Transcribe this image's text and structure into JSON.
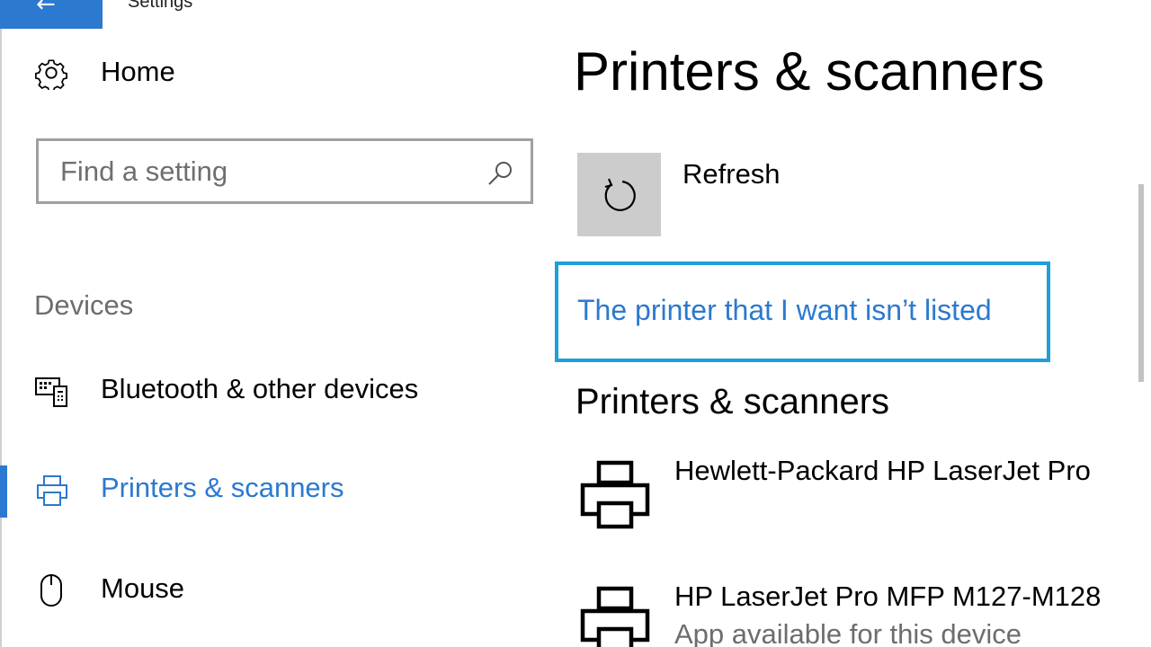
{
  "window": {
    "title": "Settings",
    "back_arrow": "←",
    "accent_color": "#2b79d0",
    "focus_color": "#1e9fd9"
  },
  "sidebar": {
    "home": {
      "label": "Home",
      "icon": "gear-icon"
    },
    "search": {
      "placeholder": "Find a setting",
      "value": ""
    },
    "section": "Devices",
    "items": [
      {
        "label": "Bluetooth & other devices",
        "icon": "keyboard-phone-icon",
        "selected": false
      },
      {
        "label": "Printers & scanners",
        "icon": "printer-icon",
        "selected": true
      },
      {
        "label": "Mouse",
        "icon": "mouse-icon",
        "selected": false
      }
    ]
  },
  "main": {
    "title": "Printers & scanners",
    "refresh_label": "Refresh",
    "printer_not_listed_link": "The printer that I want isn’t listed",
    "section_heading": "Printers & scanners",
    "devices": [
      {
        "name": "Hewlett-Packard HP LaserJet Pro",
        "status": ""
      },
      {
        "name": "HP LaserJet Pro MFP M127-M128",
        "status": "App available for this device"
      }
    ]
  }
}
